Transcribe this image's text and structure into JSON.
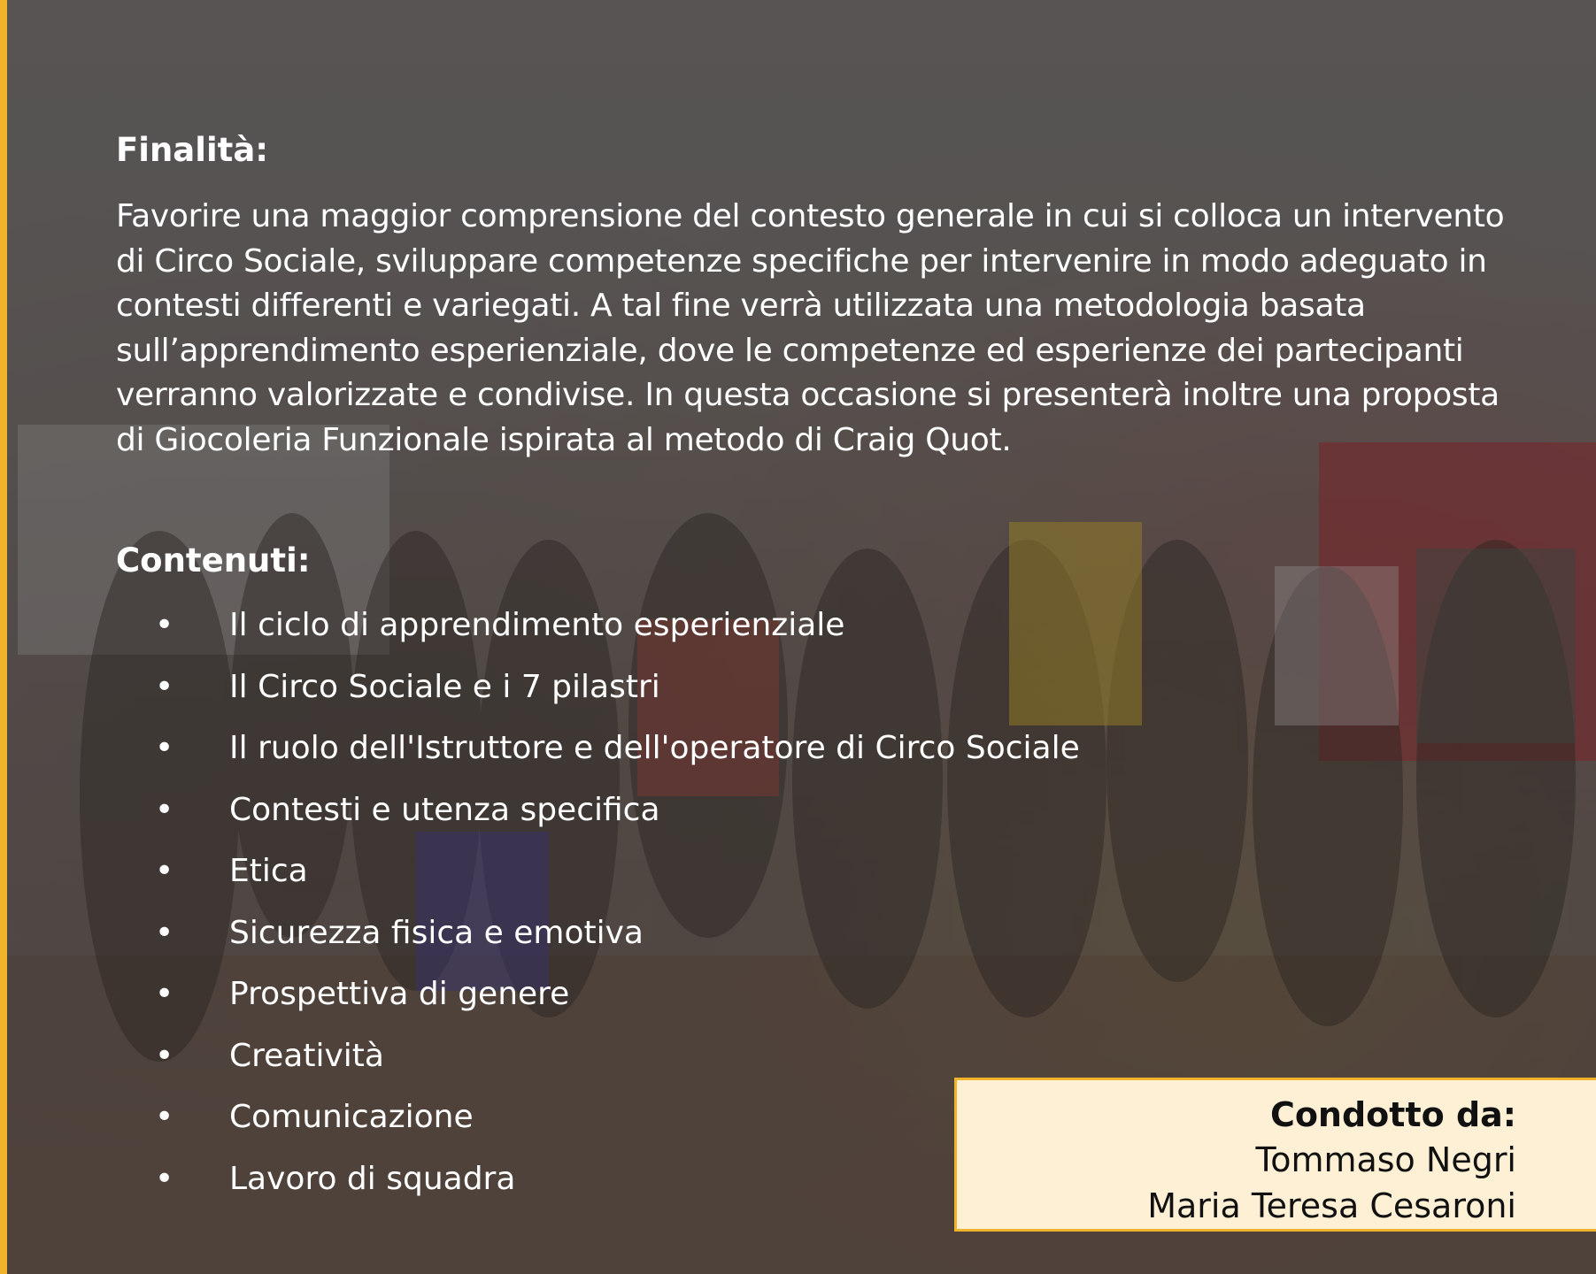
{
  "finalita": {
    "heading": "Finalità:",
    "lines": [
      "Favorire una maggior comprensione del contesto generale in cui si colloca un intervento",
      "di Circo Sociale, sviluppare competenze specifiche per intervenire in modo adeguato in",
      "contesti differenti e variegati.  A tal fine verrà utilizzata una metodologia basata",
      "sull’apprendimento esperienziale, dove le competenze ed esperienze dei partecipanti",
      "verranno valorizzate e condivise. In questa occasione si presenterà inoltre una proposta",
      "di Giocoleria Funzionale ispirata al metodo di Craig Quot."
    ]
  },
  "contenuti": {
    "heading": "Contenuti:",
    "bullet_glyph": "•",
    "items": [
      "Il ciclo di apprendimento esperienziale",
      "Il Circo Sociale e i 7 pilastri",
      "Il ruolo dell'Istruttore e dell'operatore di Circo Sociale",
      "Contesti e utenza specifica",
      "Etica",
      "Sicurezza fisica e emotiva",
      "Prospettiva di genere",
      "Creatività",
      "Comunicazione",
      "Lavoro di squadra"
    ]
  },
  "credits": {
    "title": "Condotto da:",
    "names": [
      "Tommaso Negri",
      "Maria Teresa Cesaroni"
    ]
  },
  "colors": {
    "accent": "#f0b32a",
    "credit_box_bg": "#fdf0d5",
    "text": "#ffffff"
  }
}
